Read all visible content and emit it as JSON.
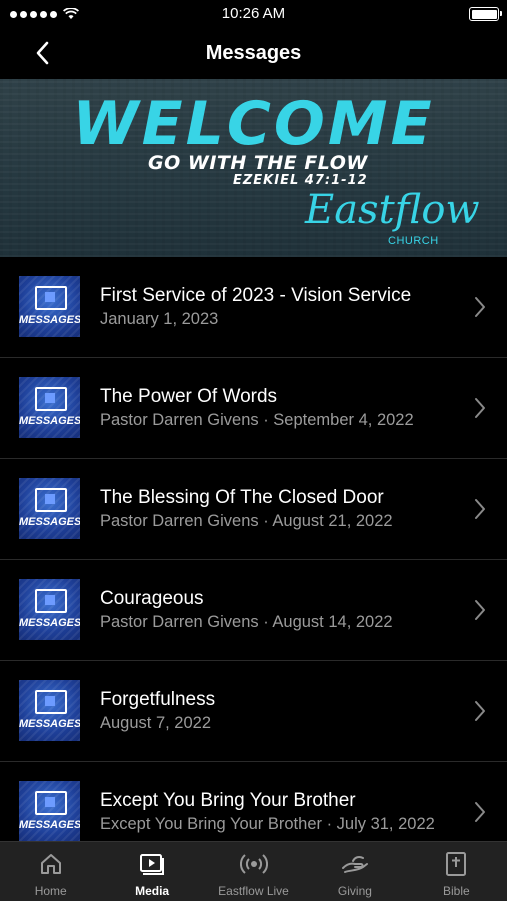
{
  "status_bar": {
    "time": "10:26 AM"
  },
  "nav": {
    "title": "Messages"
  },
  "banner": {
    "headline": "WELCOME",
    "subtitle": "GO WITH THE FLOW",
    "scripture": "EZEKIEL 47:1-12",
    "brand": "Eastflow",
    "brand_sub": "CHURCH"
  },
  "messages": [
    {
      "thumb_label": "MESSAGES",
      "title": "First Service of 2023 - Vision Service",
      "subtitle": "January 1, 2023"
    },
    {
      "thumb_label": "MESSAGES",
      "title": "The Power Of Words",
      "subtitle": "Pastor Darren Givens · September 4, 2022"
    },
    {
      "thumb_label": "MESSAGES",
      "title": "The Blessing Of The Closed Door",
      "subtitle": "Pastor Darren Givens · August 21, 2022"
    },
    {
      "thumb_label": "MESSAGES",
      "title": "Courageous",
      "subtitle": "Pastor Darren Givens · August 14, 2022"
    },
    {
      "thumb_label": "MESSAGES",
      "title": "Forgetfulness",
      "subtitle": "August 7, 2022"
    },
    {
      "thumb_label": "MESSAGES",
      "title": "Except You Bring Your Brother",
      "subtitle": "Except You Bring Your Brother · July 31, 2022"
    }
  ],
  "tabs": [
    {
      "label": "Home",
      "icon": "home-icon",
      "active": false
    },
    {
      "label": "Media",
      "icon": "media-icon",
      "active": true
    },
    {
      "label": "Eastflow Live",
      "icon": "broadcast-icon",
      "active": false
    },
    {
      "label": "Giving",
      "icon": "giving-hand-icon",
      "active": false
    },
    {
      "label": "Bible",
      "icon": "bible-icon",
      "active": false
    }
  ],
  "colors": {
    "accent": "#38d4e6",
    "thumb_blue": "#1e3f98",
    "tab_inactive": "#9a9a9a"
  }
}
